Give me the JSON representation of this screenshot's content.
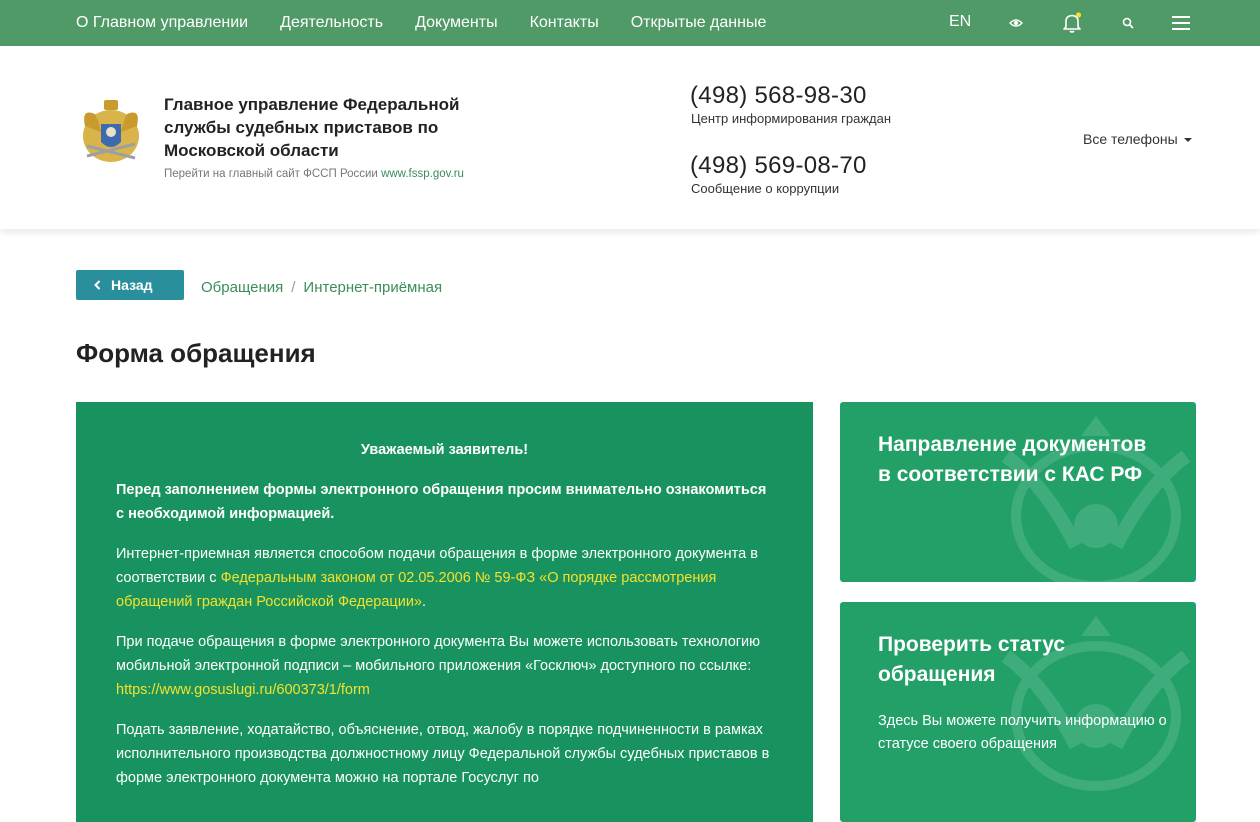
{
  "topnav": {
    "items": [
      "О Главном управлении",
      "Деятельность",
      "Документы",
      "Контакты",
      "Открытые данные"
    ],
    "lang": "EN",
    "icons": [
      "eye-icon",
      "bell-icon",
      "search-icon",
      "menu-icon"
    ]
  },
  "header": {
    "org_name": "Главное управление Федеральной службы судебных приставов по Московской области",
    "link_text": "Перейти на главный сайт ФССП России",
    "link_url": "www.fssp.gov.ru",
    "phone1": "(498) 568-98-30",
    "phone1_caption": "Центр информирования граждан",
    "phone2": "(498) 569-08-70",
    "phone2_caption": "Сообщение о коррупции",
    "all_phones": "Все телефоны"
  },
  "breadcrumb": {
    "back": "Назад",
    "items": [
      "Обращения",
      "Интернет-приёмная"
    ],
    "separator": "/"
  },
  "page_title": "Форма обращения",
  "main": {
    "greeting": "Уважаемый заявитель!",
    "p1": "Перед заполнением формы электронного обращения просим внимательно ознакомиться с необходимой информацией.",
    "p2_start": "Интернет-приемная является способом подачи обращения в форме электронного документа в соответствии с ",
    "p2_link": "Федеральным законом от 02.05.2006 № 59-ФЗ «О порядке рассмотрения обращений граждан Российской Федерации»",
    "p2_end": ".",
    "p3_start": "При подаче обращения в форме электронного документа Вы можете использовать технологию мобильной электронной подписи – мобильного приложения «Госключ» доступного по ссылке: ",
    "p3_link": "https://www.gosuslugi.ru/600373/1/form",
    "p4": "Подать заявление, ходатайство, объяснение, отвод, жалобу в порядке подчиненности в рамках исполнительного производства должностному лицу Федеральной службы судебных приставов в форме электронного документа можно на портале Госуслуг по"
  },
  "side": {
    "card1_title": "Направление документов в соответствии с КАС РФ",
    "card2_title": "Проверить статус обращения",
    "card2_desc": "Здесь Вы можете получить информацию о статусе своего обращения"
  },
  "colors": {
    "nav_green": "#4f9a66",
    "main_green": "#18935f",
    "card_green": "#22a068",
    "back_button": "#2a8f9c",
    "link_yellow": "#f4e12d",
    "bell_dot": "#f4e12d"
  }
}
